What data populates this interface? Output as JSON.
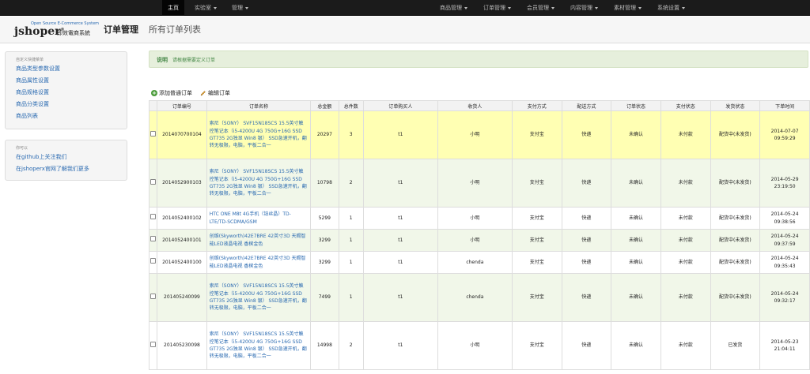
{
  "topnav": {
    "left": [
      {
        "label": "主页",
        "active": true,
        "caret": false
      },
      {
        "label": "实验室",
        "active": false,
        "caret": true
      },
      {
        "label": "管理",
        "active": false,
        "caret": true
      }
    ],
    "right": [
      {
        "label": "商品管理"
      },
      {
        "label": "订单管理"
      },
      {
        "label": "会员管理"
      },
      {
        "label": "内容管理"
      },
      {
        "label": "素材管理"
      },
      {
        "label": "系统设置"
      }
    ]
  },
  "header": {
    "logo_tagline": "Open Source E-Commerce System",
    "logo_name": "jshoper",
    "logo_reg": "®",
    "logo_sub": "即效電商系統",
    "title": "订单管理",
    "subtitle": "所有订单列表"
  },
  "sidebar": {
    "box1": {
      "heading": "自定义快捷菜单",
      "links": [
        "商品类型参数设置",
        "商品属性设置",
        "商品规格设置",
        "商品分类设置",
        "商品列表"
      ]
    },
    "box2": {
      "heading": "你可以",
      "links": [
        "在github上关注我们",
        "在jshoperx官网了解我们更多"
      ]
    }
  },
  "notice": {
    "label": "说明",
    "text": "请根据需要定义订单"
  },
  "toolbar": {
    "add_label": "添加普通订单",
    "edit_label": "编辑订单"
  },
  "table": {
    "columns": [
      "",
      "订单编号",
      "订单名称",
      "总金额",
      "总件数",
      "订单购买人",
      "收货人",
      "支付方式",
      "配送方式",
      "订单状态",
      "支付状态",
      "发货状态",
      "下单时间"
    ],
    "rows": [
      {
        "id": "2014070700104",
        "name": "索尼（SONY） SVF15N18SCS 15.5英寸触控笔记本（i5-4200U 4G 750G+16G SSD GT735 2G独显 Win8 银） SSD急速开机，翻转无极限，电脑，平板二合一",
        "total": "20297",
        "qty": "3",
        "buyer": "t1",
        "receiver": "小明",
        "pay": "支付宝",
        "ship": "快递",
        "order_status": "未确认",
        "pay_status": "未付款",
        "ship_status": "配货中(未发货)",
        "date": "2014-07-07",
        "time": "09:59:29",
        "style": "hl"
      },
      {
        "id": "2014052900103",
        "name": "索尼（SONY） SVF15N18SCS 15.5英寸触控笔记本（i5-4200U 4G 750G+16G SSD GT735 2G独显 Win8 银） SSD急速开机，翻转无极限，电脑，平板二合一",
        "total": "10798",
        "qty": "2",
        "buyer": "t1",
        "receiver": "小明",
        "pay": "支付宝",
        "ship": "快递",
        "order_status": "未确认",
        "pay_status": "未付款",
        "ship_status": "配货中(未发货)",
        "date": "2014-05-29",
        "time": "23:19:50",
        "style": "alt"
      },
      {
        "id": "2014052400102",
        "name": "HTC ONE M8t 4G手机（铂丝晶）TD-LTE/TD-SCDMA/GSM",
        "total": "5299",
        "qty": "1",
        "buyer": "t1",
        "receiver": "小明",
        "pay": "支付宝",
        "ship": "快递",
        "order_status": "未确认",
        "pay_status": "未付款",
        "ship_status": "配货中(未发货)",
        "date": "2014-05-24",
        "time": "09:38:56",
        "style": ""
      },
      {
        "id": "2014052400101",
        "name": "创维(Skyworth)42E7BRE 42英寸3D 天赐智能LED液晶电视 香槟金色",
        "total": "3299",
        "qty": "1",
        "buyer": "t1",
        "receiver": "小明",
        "pay": "支付宝",
        "ship": "快递",
        "order_status": "未确认",
        "pay_status": "未付款",
        "ship_status": "配货中(未发货)",
        "date": "2014-05-24",
        "time": "09:37:59",
        "style": "alt"
      },
      {
        "id": "2014052400100",
        "name": "创维(Skyworth)42E7BRE 42英寸3D 天赐智能LED液晶电视 香槟金色",
        "total": "3299",
        "qty": "1",
        "buyer": "t1",
        "receiver": "chenda",
        "pay": "支付宝",
        "ship": "快递",
        "order_status": "未确认",
        "pay_status": "未付款",
        "ship_status": "配货中(未发货)",
        "date": "2014-05-24",
        "time": "09:35:43",
        "style": ""
      },
      {
        "id": "201405240099",
        "name": "索尼（SONY） SVF15N18SCS 15.5英寸触控笔记本（i5-4200U 4G 750G+16G SSD GT735 2G独显 Win8 银） SSD急速开机，翻转无极限，电脑，平板二合一",
        "total": "7499",
        "qty": "1",
        "buyer": "t1",
        "receiver": "chenda",
        "pay": "支付宝",
        "ship": "快递",
        "order_status": "未确认",
        "pay_status": "未付款",
        "ship_status": "配货中(未发货)",
        "date": "2014-05-24",
        "time": "09:32:17",
        "style": "alt"
      },
      {
        "id": "201405230098",
        "name": "索尼（SONY） SVF15N18SCS 15.5英寸触控笔记本（i5-4200U 4G 750G+16G SSD GT735 2G独显 Win8 银） SSD急速开机，翻转无极限，电脑，平板二合一",
        "total": "14998",
        "qty": "2",
        "buyer": "t1",
        "receiver": "小明",
        "pay": "支付宝",
        "ship": "快递",
        "order_status": "未确认",
        "pay_status": "未付款",
        "ship_status": "已发货",
        "date": "2014-05-23",
        "time": "21:04:11",
        "style": ""
      }
    ]
  }
}
